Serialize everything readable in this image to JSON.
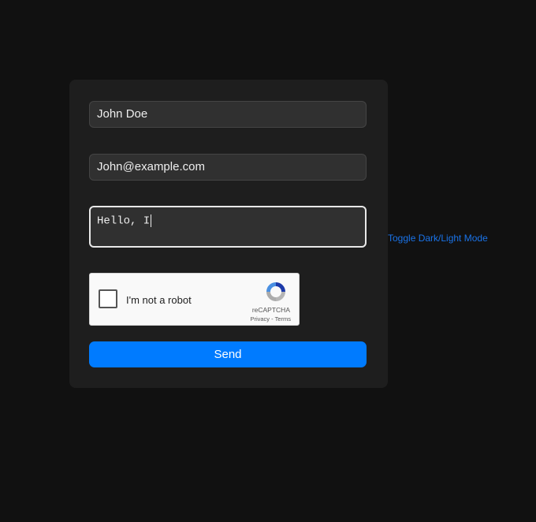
{
  "form": {
    "name_value": "John Doe",
    "email_value": "John@example.com",
    "message_value": "Hello, I",
    "send_label": "Send"
  },
  "captcha": {
    "label": "I'm not a robot",
    "brand": "reCAPTCHA",
    "terms": "Privacy - Terms"
  },
  "toggle_label": "Toggle Dark/Light Mode",
  "colors": {
    "accent": "#007bff",
    "background": "#111111",
    "card": "#1e1e1e"
  }
}
